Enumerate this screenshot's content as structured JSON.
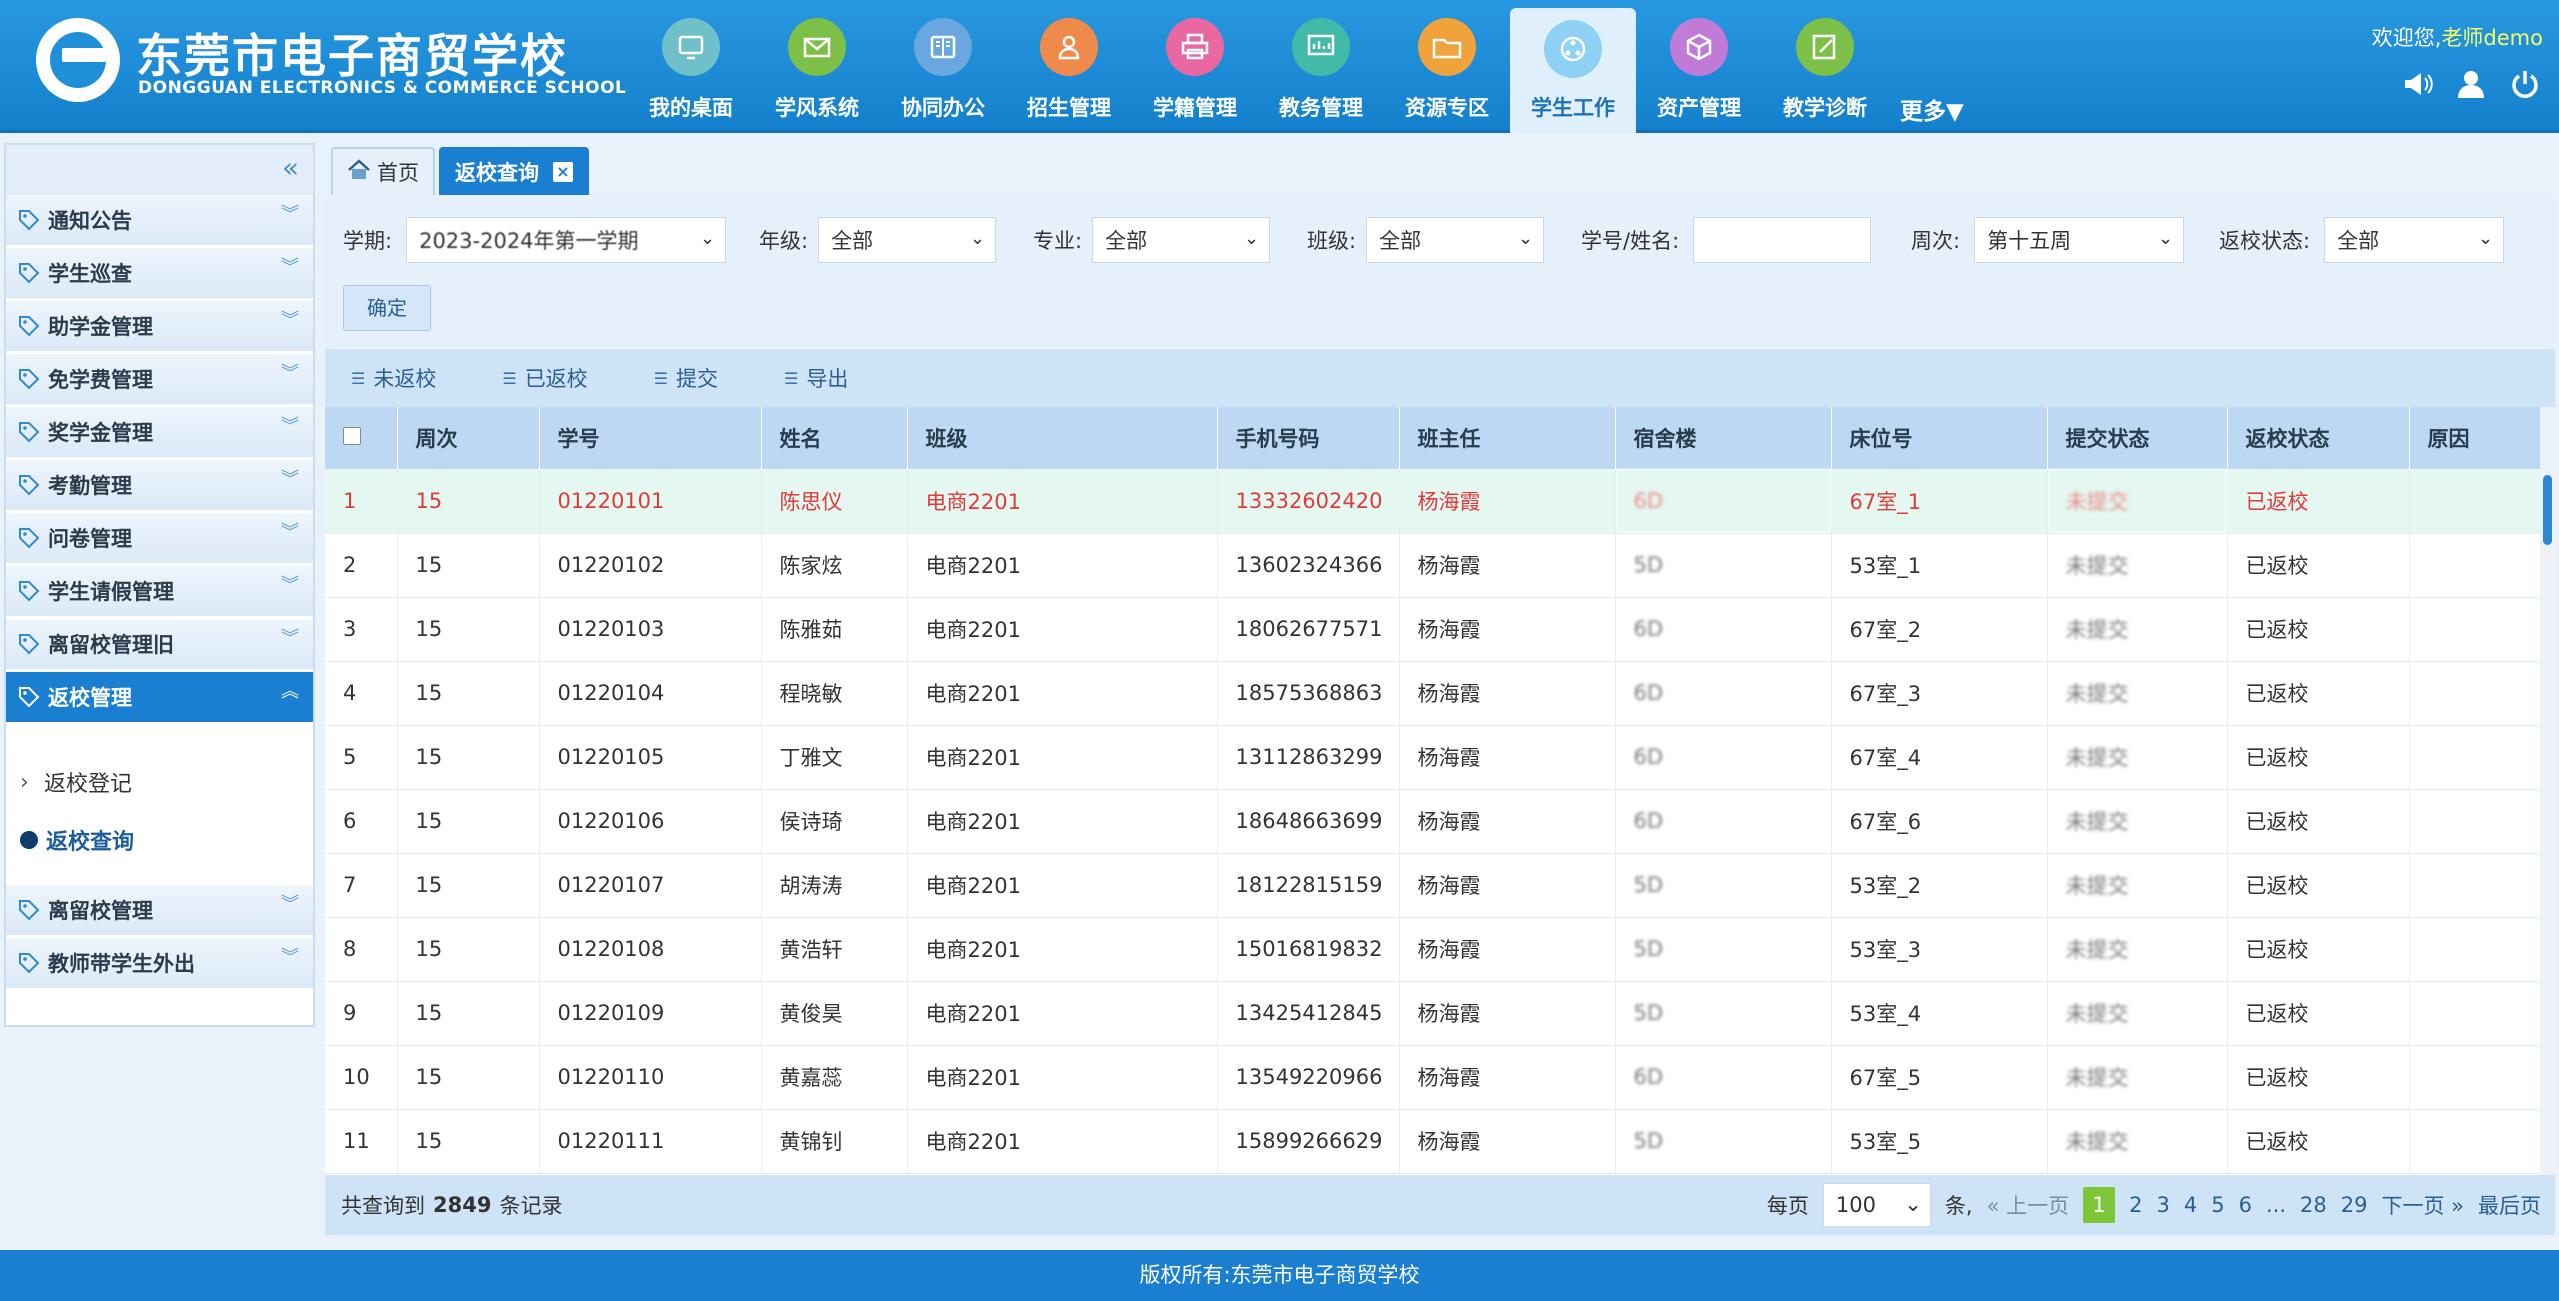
{
  "header": {
    "logo_cn": "东莞市电子商贸学校",
    "logo_en": "DONGGUAN ELECTRONICS & COMMERCE SCHOOL",
    "welcome": "欢迎您,",
    "user": "老师demo",
    "more": "更多▼",
    "nav": [
      {
        "label": "我的桌面",
        "icon": "desktop-icon",
        "color": "#6fc0c8"
      },
      {
        "label": "学风系统",
        "icon": "mail-icon",
        "color": "#7cc047"
      },
      {
        "label": "协同办公",
        "icon": "book-icon",
        "color": "#6aa6df"
      },
      {
        "label": "招生管理",
        "icon": "person-icon",
        "color": "#f08a4b"
      },
      {
        "label": "学籍管理",
        "icon": "printer-icon",
        "color": "#e968a2"
      },
      {
        "label": "教务管理",
        "icon": "chart-icon",
        "color": "#43b9a8"
      },
      {
        "label": "资源专区",
        "icon": "folder-icon",
        "color": "#f0a33a"
      },
      {
        "label": "学生工作",
        "icon": "network-icon",
        "color": "#8ed1f5"
      },
      {
        "label": "资产管理",
        "icon": "box-icon",
        "color": "#c07ad8"
      },
      {
        "label": "教学诊断",
        "icon": "edit-icon",
        "color": "#7cc047"
      }
    ]
  },
  "sidebar": {
    "items_top": [
      "通知公告",
      "学生巡查",
      "助学金管理",
      "免学费管理",
      "奖学金管理",
      "考勤管理",
      "问卷管理",
      "学生请假管理",
      "离留校管理旧"
    ],
    "open_item": "返校管理",
    "sub": [
      "返校登记",
      "返校查询"
    ],
    "items_bottom": [
      "离留校管理",
      "教师带学生外出"
    ]
  },
  "tabs": {
    "home": "首页",
    "current": "返校查询"
  },
  "filters": {
    "term_label": "学期:",
    "term_value": "2023-2024年第一学期",
    "grade_label": "年级:",
    "grade_value": "全部",
    "major_label": "专业:",
    "major_value": "全部",
    "class_label": "班级:",
    "class_value": "全部",
    "id_label": "学号/姓名:",
    "id_value": "",
    "week_label": "周次:",
    "week_value": "第十五周",
    "status_label": "返校状态:",
    "status_value": "全部",
    "ok": "确定"
  },
  "toolbar": [
    "未返校",
    "已返校",
    "提交",
    "导出"
  ],
  "table": {
    "headers": [
      "周次",
      "学号",
      "姓名",
      "班级",
      "手机号码",
      "班主任",
      "宿舍楼",
      "床位号",
      "提交状态",
      "返校状态",
      "原因"
    ],
    "rows": [
      [
        "1",
        "15",
        "01220101",
        "陈思仪",
        "电商2201",
        "13332602420",
        "杨海霞",
        "6D",
        "67室_1",
        "未提交",
        "已返校",
        ""
      ],
      [
        "2",
        "15",
        "01220102",
        "陈家炫",
        "电商2201",
        "13602324366",
        "杨海霞",
        "5D",
        "53室_1",
        "未提交",
        "已返校",
        ""
      ],
      [
        "3",
        "15",
        "01220103",
        "陈雅茹",
        "电商2201",
        "18062677571",
        "杨海霞",
        "6D",
        "67室_2",
        "未提交",
        "已返校",
        ""
      ],
      [
        "4",
        "15",
        "01220104",
        "程晓敏",
        "电商2201",
        "18575368863",
        "杨海霞",
        "6D",
        "67室_3",
        "未提交",
        "已返校",
        ""
      ],
      [
        "5",
        "15",
        "01220105",
        "丁雅文",
        "电商2201",
        "13112863299",
        "杨海霞",
        "6D",
        "67室_4",
        "未提交",
        "已返校",
        ""
      ],
      [
        "6",
        "15",
        "01220106",
        "侯诗琦",
        "电商2201",
        "18648663699",
        "杨海霞",
        "6D",
        "67室_6",
        "未提交",
        "已返校",
        ""
      ],
      [
        "7",
        "15",
        "01220107",
        "胡涛涛",
        "电商2201",
        "18122815159",
        "杨海霞",
        "5D",
        "53室_2",
        "未提交",
        "已返校",
        ""
      ],
      [
        "8",
        "15",
        "01220108",
        "黄浩轩",
        "电商2201",
        "15016819832",
        "杨海霞",
        "5D",
        "53室_3",
        "未提交",
        "已返校",
        ""
      ],
      [
        "9",
        "15",
        "01220109",
        "黄俊昊",
        "电商2201",
        "13425412845",
        "杨海霞",
        "5D",
        "53室_4",
        "未提交",
        "已返校",
        ""
      ],
      [
        "10",
        "15",
        "01220110",
        "黄嘉蕊",
        "电商2201",
        "13549220966",
        "杨海霞",
        "6D",
        "67室_5",
        "未提交",
        "已返校",
        ""
      ],
      [
        "11",
        "15",
        "01220111",
        "黄锦钊",
        "电商2201",
        "15899266629",
        "杨海霞",
        "5D",
        "53室_5",
        "未提交",
        "已返校",
        ""
      ]
    ]
  },
  "footer": {
    "total_prefix": "共查询到",
    "total": "2849",
    "total_suffix": "条记录",
    "per_page_label": "每页",
    "per_page": "100",
    "per_page_unit": "条,",
    "prev": "« 上一页",
    "pages": [
      "1",
      "2",
      "3",
      "4",
      "5",
      "6",
      "...",
      "28",
      "29"
    ],
    "next": "下一页 »",
    "last": "最后页"
  },
  "copyright": "版权所有:东莞市电子商贸学校"
}
